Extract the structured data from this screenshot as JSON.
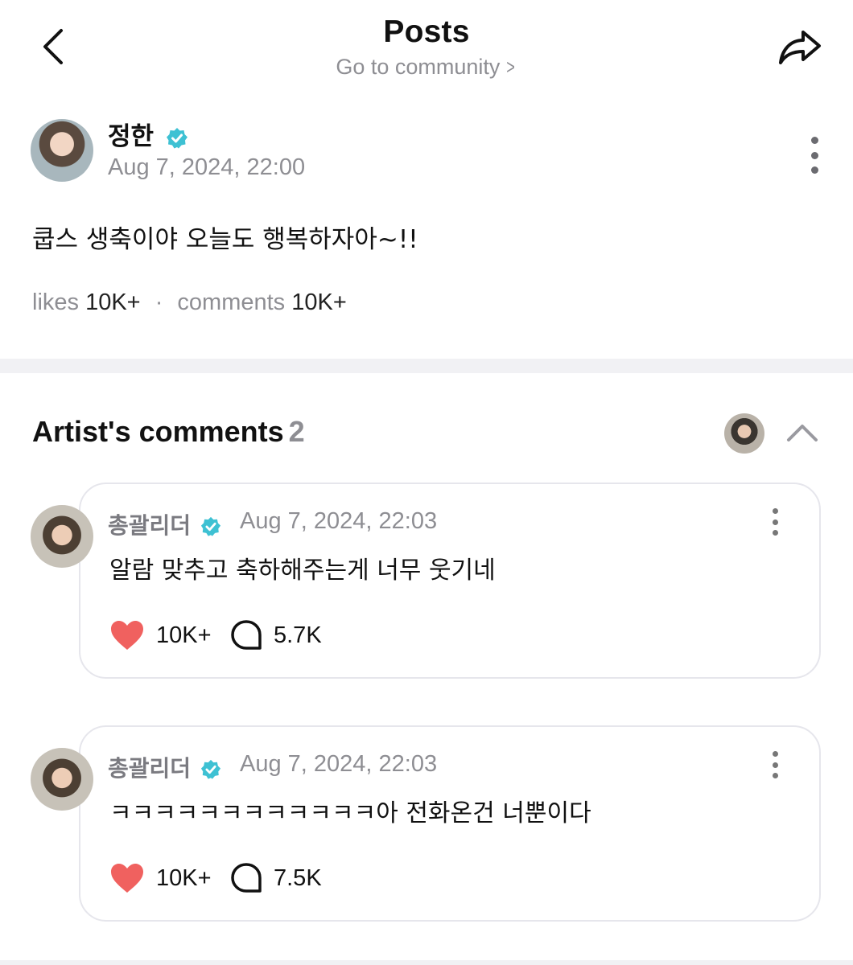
{
  "header": {
    "title": "Posts",
    "subtitle": "Go to community",
    "subtitle_chevron": ">"
  },
  "post": {
    "author": "정한",
    "date": "Aug 7, 2024, 22:00",
    "body": "쿱스 생축이야 오늘도 행복하자아~!!",
    "likes_label": "likes",
    "likes_value": "10K+",
    "separator": "·",
    "comments_label": "comments",
    "comments_value": "10K+"
  },
  "artist_comments": {
    "title": "Artist's comments",
    "count": "2",
    "items": [
      {
        "author": "총괄리더",
        "date": "Aug 7, 2024, 22:03",
        "text": "알람 맞추고 축하해주는게 너무 웃기네",
        "likes": "10K+",
        "replies": "5.7K"
      },
      {
        "author": "총괄리더",
        "date": "Aug 7, 2024, 22:03",
        "text": "ㅋㅋㅋㅋㅋㅋㅋㅋㅋㅋㅋㅋ아 전화온건 너뿐이다",
        "likes": "10K+",
        "replies": "7.5K"
      }
    ]
  },
  "icons": {
    "back": "chevron-left-icon",
    "share": "share-arrow-icon",
    "verified": "verified-badge-icon",
    "more": "more-vertical-icon",
    "collapse": "chevron-up-icon",
    "like": "heart-icon",
    "reply": "speech-bubble-icon"
  },
  "colors": {
    "verified": "#3ec1d3",
    "heart": "#f0615f",
    "muted_text": "#8e8e93",
    "divider": "#f1f1f4"
  }
}
